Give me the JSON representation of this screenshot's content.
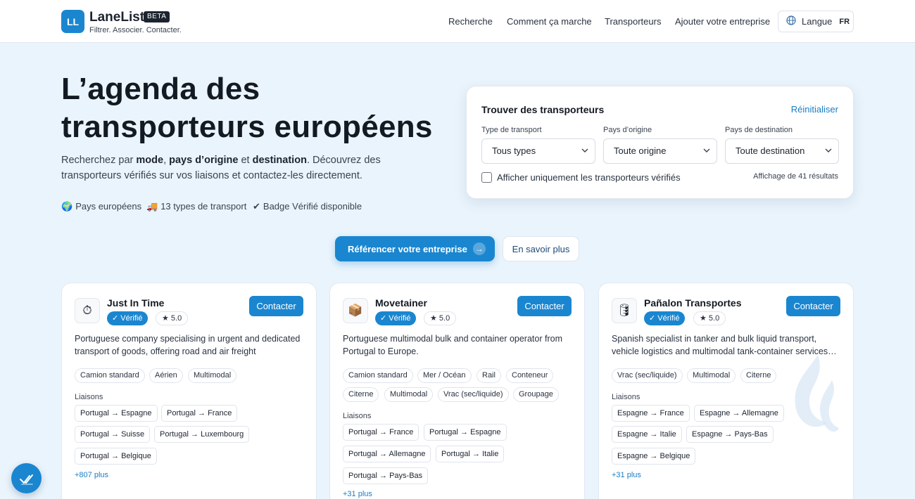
{
  "header": {
    "logo_text": "LL",
    "brand": "LaneList",
    "beta": "BETA",
    "tagline": "Filtrer. Associer. Contacter.",
    "nav": [
      "Recherche",
      "Comment ça marche",
      "Transporteurs",
      "Ajouter votre entreprise"
    ],
    "language_label": "Langue",
    "language_code": "FR",
    "language_icon": "globe-icon"
  },
  "hero": {
    "title_line1": "L’agenda des",
    "title_line2": "transporteurs européens",
    "desc": {
      "p1": "Recherchez par ",
      "b1": "mode",
      "p2": ", ",
      "b2": "pays d’origine",
      "p3": " et ",
      "b3": "destination",
      "p4": ". Découvrez des transporteurs vérifiés sur vos liaisons et contactez-les directement."
    },
    "features": [
      {
        "emoji": "🌍",
        "text": "Pays européens"
      },
      {
        "emoji": "🚚",
        "text": "13 types de transport"
      },
      {
        "emoji": "✔",
        "text": "Badge Vérifié disponible"
      }
    ]
  },
  "search": {
    "title": "Trouver des transporteurs",
    "reset": "Réinitialiser",
    "filters": [
      {
        "label": "Type de transport",
        "value": "Tous types"
      },
      {
        "label": "Pays d’origine",
        "value": "Toute origine"
      },
      {
        "label": "Pays de destination",
        "value": "Toute destination"
      }
    ],
    "verified_only_label": "Afficher uniquement les transporteurs vérifiés",
    "verified_only_checked": false,
    "results": "Affichage de 41 résultats"
  },
  "cta": {
    "primary": "Référencer votre entreprise",
    "primary_icon": "arrow-right-icon",
    "secondary": "En savoir plus"
  },
  "cards": [
    {
      "icon": "stopwatch-icon",
      "icon_glyph": "⏱",
      "name": "Just In Time",
      "verified": "Vérifié",
      "rating": "★ 5.0",
      "contact": "Contacter",
      "desc": "Portuguese company specialising in urgent and dedicated transport of goods, offering road and air freight",
      "modes": [
        "Camion standard",
        "Aérien",
        "Multimodal"
      ],
      "liaisons_label": "Liaisons",
      "routes": [
        "Portugal → Espagne",
        "Portugal → France",
        "Portugal → Suisse",
        "Portugal → Luxembourg",
        "Portugal → Belgique"
      ],
      "more": "+807 plus"
    },
    {
      "icon": "package-icon",
      "icon_glyph": "📦",
      "name": "Movetainer",
      "verified": "Vérifié",
      "rating": "★ 5.0",
      "contact": "Contacter",
      "desc": "Portuguese multimodal bulk and container operator from Portugal to Europe.",
      "modes": [
        "Camion standard",
        "Mer / Océan",
        "Rail",
        "Conteneur",
        "Citerne",
        "Multimodal",
        "Vrac (sec/liquide)",
        "Groupage"
      ],
      "liaisons_label": "Liaisons",
      "routes": [
        "Portugal → France",
        "Portugal → Espagne",
        "Portugal → Allemagne",
        "Portugal → Italie",
        "Portugal → Pays-Bas"
      ],
      "more": "+31 plus"
    },
    {
      "icon": "barrel-icon",
      "icon_glyph": "🛢",
      "name": "Pañalon Transportes",
      "verified": "Vérifié",
      "rating": "★ 5.0",
      "contact": "Contacter",
      "desc": "Spanish specialist in tanker and bulk liquid transport, vehicle logistics and multimodal tank-container services…",
      "modes": [
        "Vrac (sec/liquide)",
        "Multimodal",
        "Citerne"
      ],
      "liaisons_label": "Liaisons",
      "routes": [
        "Espagne → France",
        "Espagne → Allemagne",
        "Espagne → Italie",
        "Espagne → Pays-Bas",
        "Espagne → Belgique"
      ],
      "more": "+31 plus"
    }
  ],
  "fab_icon": "double-check-icon",
  "colors": {
    "accent": "#1a86d0",
    "background": "#eaf4fc",
    "text": "#141a22"
  }
}
